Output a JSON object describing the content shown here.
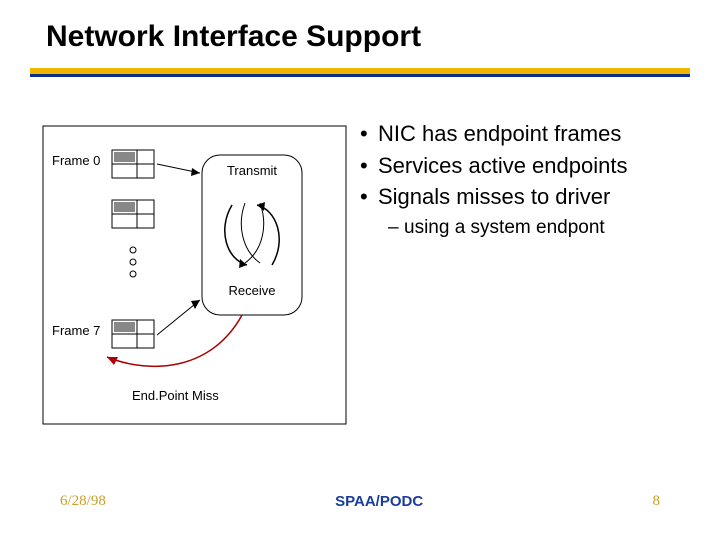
{
  "title": "Network Interface Support",
  "bullets": [
    "NIC has endpoint frames",
    "Services active endpoints",
    "Signals misses to driver"
  ],
  "subbullet": "using a system endpont",
  "diagram": {
    "frame0": "Frame 0",
    "frame7": "Frame 7",
    "transmit": "Transmit",
    "receive": "Receive",
    "miss": "End.Point Miss"
  },
  "footer": {
    "left": "6/28/98",
    "center": "SPAA/PODC",
    "right": "8"
  }
}
